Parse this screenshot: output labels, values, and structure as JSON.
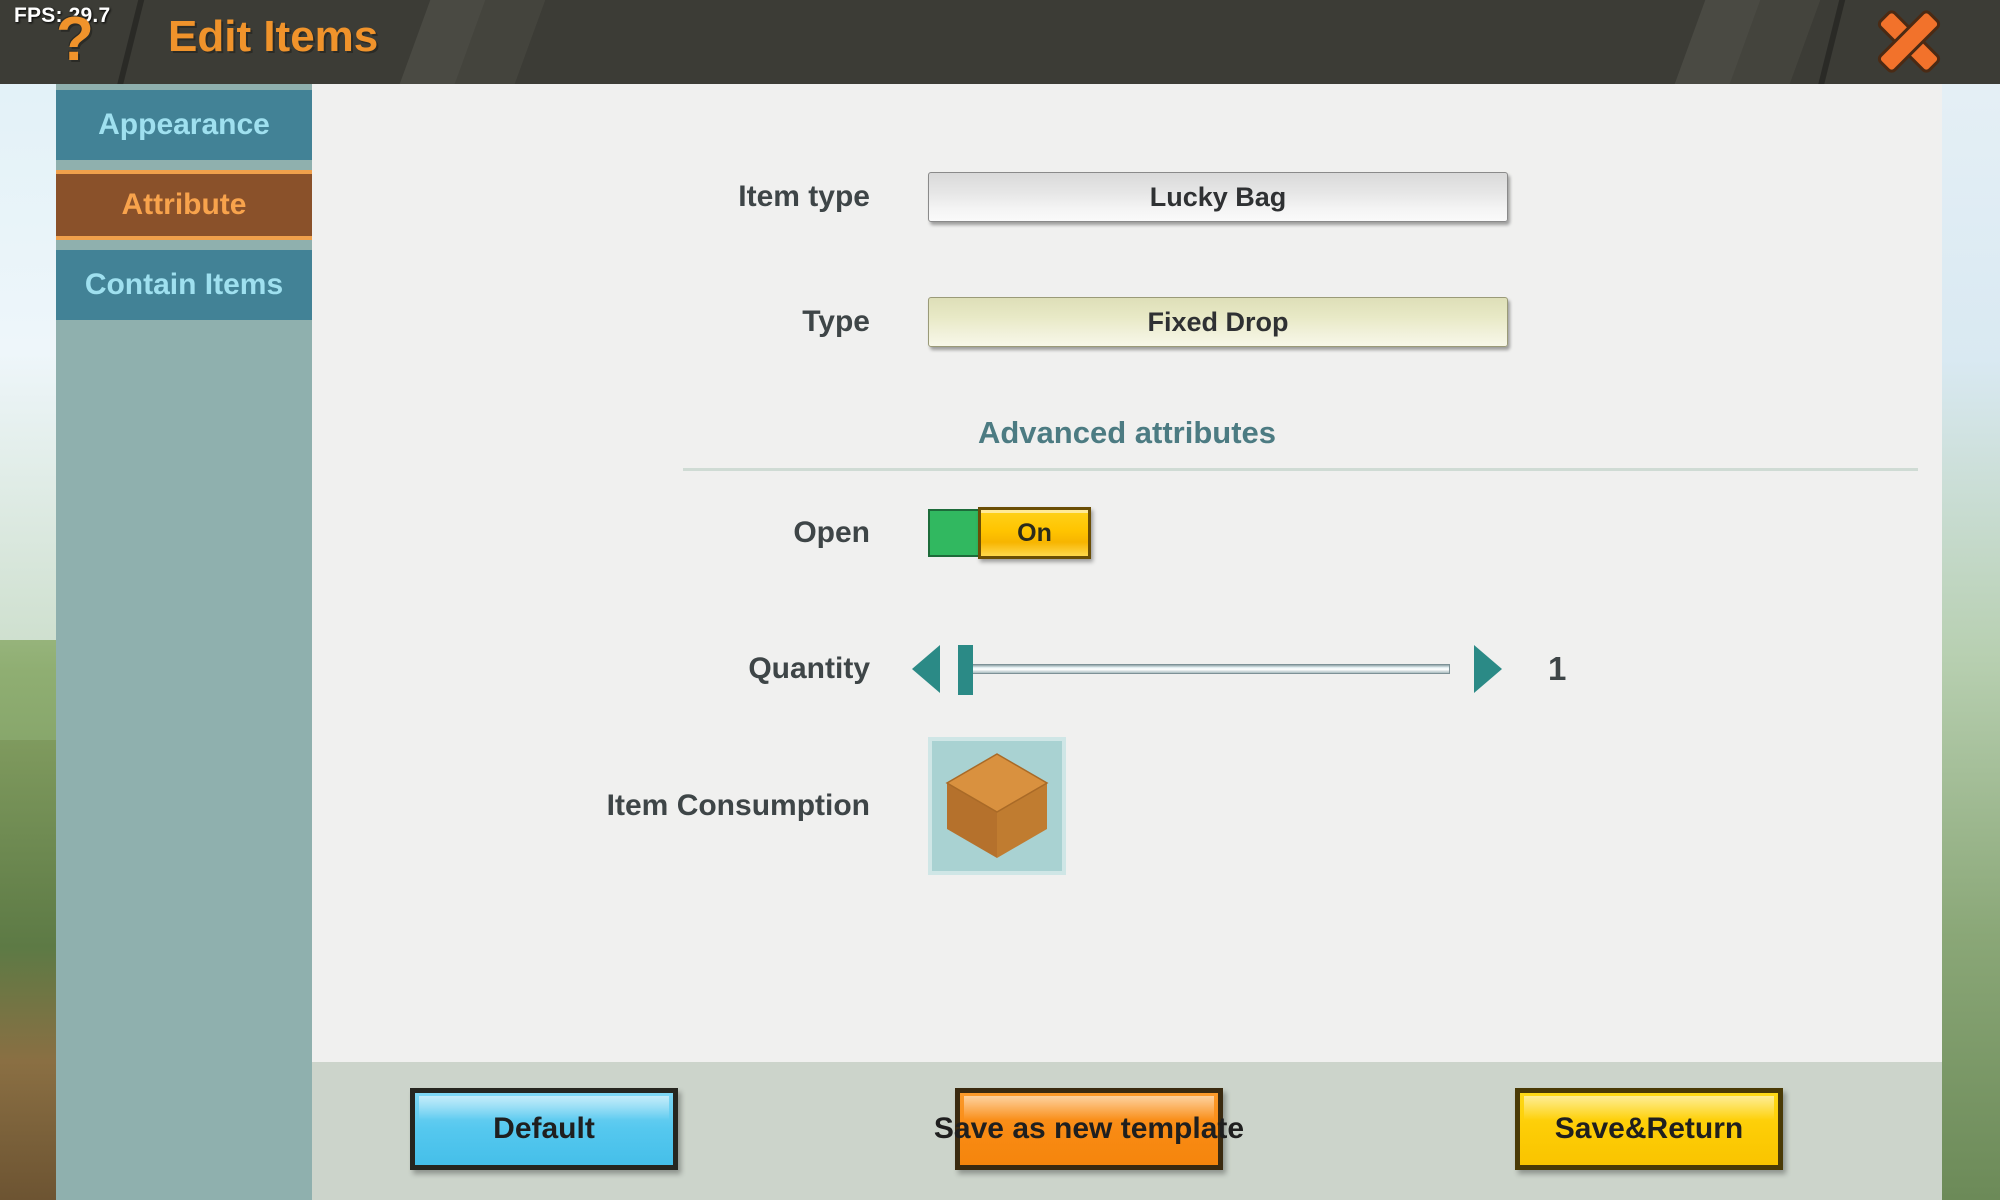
{
  "header": {
    "fps": "FPS: 29.7",
    "help_icon": "question-mark-icon",
    "title": "Edit Items",
    "close_icon": "close-icon"
  },
  "sidebar": {
    "items": [
      {
        "label": "Appearance",
        "active": false
      },
      {
        "label": "Attribute",
        "active": true
      },
      {
        "label": "Contain Items",
        "active": false
      }
    ]
  },
  "form": {
    "item_type": {
      "label": "Item type",
      "value": "Lucky Bag"
    },
    "type": {
      "label": "Type",
      "value": "Fixed Drop"
    },
    "advanced_title": "Advanced attributes",
    "open": {
      "label": "Open",
      "value": "On"
    },
    "quantity": {
      "label": "Quantity",
      "value": "1",
      "min": "1",
      "max": "99"
    },
    "item_consumption": {
      "label": "Item Consumption",
      "icon": "wooden-crate-icon"
    }
  },
  "footer": {
    "default_label": "Default",
    "save_template_label": "Save as new template",
    "save_return_label": "Save&Return"
  },
  "colors": {
    "accent_orange": "#f0932b",
    "sidebar_active": "#8a512a",
    "sidebar_inactive": "#428296",
    "teal": "#2b8a86",
    "toggle_on": "#ffc400",
    "toggle_green": "#31b860"
  }
}
